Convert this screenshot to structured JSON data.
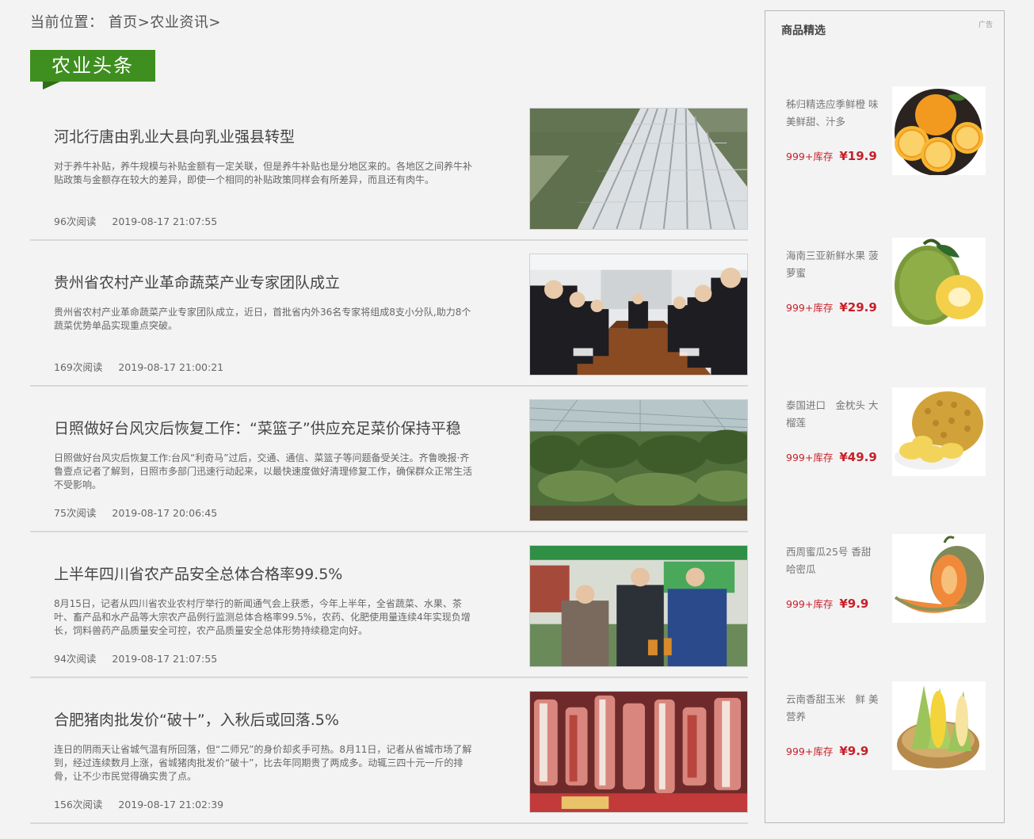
{
  "breadcrumb": {
    "prefix": "当前位置：",
    "home": "首页",
    "sep1": ">",
    "current": "农业资讯",
    "sep2": ">"
  },
  "section": {
    "title": "农业头条"
  },
  "news": [
    {
      "title": "河北行唐由乳业大县向乳业强县转型",
      "summary": "对于养牛补贴，养牛规模与补贴金额有一定关联，但是养牛补贴也是分地区来的。各地区之间养牛补贴政策与金额存在较大的差异，即使一个相同的补贴政策同样会有所差异，而且还有肉牛。",
      "reads": "96次阅读",
      "date": "2019-08-17 21:07:55",
      "image": "greenhouse-aerial-photo"
    },
    {
      "title": "贵州省农村产业革命蔬菜产业专家团队成立",
      "summary": "贵州省农村产业革命蔬菜产业专家团队成立，近日，首批省内外36名专家将组成8支小分队,助力8个蔬菜优势单品实现重点突破。",
      "reads": "169次阅读",
      "date": "2019-08-17 21:00:21",
      "image": "meeting-room-photo"
    },
    {
      "title": "日照做好台风灾后恢复工作：“菜篮子”供应充足菜价保持平稳",
      "summary": "日照做好台风灾后恢复工作:台风“利奇马”过后，交通、通信、菜篮子等问题备受关注。齐鲁晚报·齐鲁壹点记者了解到，日照市多部门迅速行动起来，以最快速度做好清理修复工作，确保群众正常生活不受影响。",
      "reads": "75次阅读",
      "date": "2019-08-17 20:06:45",
      "image": "vegetable-greenhouse-photo"
    },
    {
      "title": "上半年四川省农产品安全总体合格率99.5%",
      "summary": "8月15日，记者从四川省农业农村厅举行的新闻通气会上获悉，今年上半年，全省蔬菜、水果、茶叶、畜产品和水产品等大宗农产品例行监测总体合格率99.5%，农药、化肥使用量连续4年实现负增长，饲料兽药产品质量安全可控，农产品质量安全总体形势持续稳定向好。",
      "reads": "94次阅读",
      "date": "2019-08-17 21:07:55",
      "image": "market-inspection-photo"
    },
    {
      "title": "合肥猪肉批发价“破十”，入秋后或回落.5%",
      "summary": "连日的阴雨天让省城气温有所回落，但“二师兄”的身价却炙手可热。8月11日，记者从省城市场了解到，经过连续数月上涨，省城猪肉批发价“破十”，比去年同期贵了两成多。动辄三四十元一斤的排骨，让不少市民觉得确实贵了点。",
      "reads": "156次阅读",
      "date": "2019-08-17 21:02:39",
      "image": "pork-stall-photo"
    }
  ],
  "sidebar": {
    "title": "商品精选",
    "ad_label": "广告",
    "products": [
      {
        "name": "秭归精选应季鲜橙 味美鲜甜、汁多",
        "stock": "999+库存",
        "price": "¥19.9",
        "image": "orange-icon"
      },
      {
        "name": "海南三亚新鲜水果 菠萝蜜",
        "stock": "999+库存",
        "price": "¥29.9",
        "image": "jackfruit-icon"
      },
      {
        "name": "泰国进口　金枕头 大榴莲",
        "stock": "999+库存",
        "price": "¥49.9",
        "image": "durian-icon"
      },
      {
        "name": "西周蜜瓜25号 香甜 哈密瓜",
        "stock": "999+库存",
        "price": "¥9.9",
        "image": "melon-icon"
      },
      {
        "name": "云南香甜玉米　鲜 美营养",
        "stock": "999+库存",
        "price": "¥9.9",
        "image": "corn-icon"
      }
    ]
  },
  "colors": {
    "accent_green": "#3f8f20",
    "price_red": "#c8202a",
    "background": "#f3f3f3"
  }
}
